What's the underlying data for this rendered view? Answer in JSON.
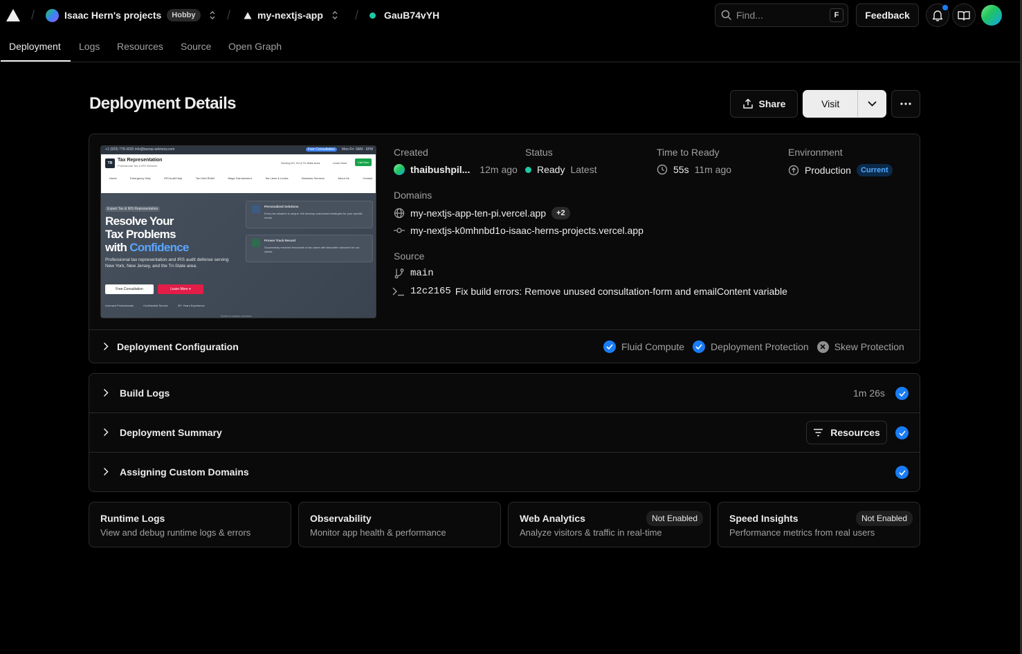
{
  "topbar": {
    "team": "Isaac Hern's projects",
    "plan": "Hobby",
    "project": "my-nextjs-app",
    "deployment_id": "GauB74vYH",
    "search_placeholder": "Find...",
    "search_shortcut": "F",
    "feedback": "Feedback"
  },
  "tabs": [
    "Deployment",
    "Logs",
    "Resources",
    "Source",
    "Open Graph"
  ],
  "page_title": "Deployment Details",
  "actions": {
    "share": "Share",
    "visit": "Visit"
  },
  "details": {
    "created_label": "Created",
    "created_user": "thaibushpil...",
    "created_ago": "12m ago",
    "status_label": "Status",
    "status_value": "Ready",
    "status_tag": "Latest",
    "time_label": "Time to Ready",
    "time_value": "55s",
    "time_ago": "11m ago",
    "env_label": "Environment",
    "env_value": "Production",
    "env_badge": "Current",
    "domains_label": "Domains",
    "domain_primary": "my-nextjs-app-ten-pi.vercel.app",
    "domain_more": "+2",
    "domain_secondary": "my-nextjs-k0mhnbd1o-isaac-herns-projects.vercel.app",
    "source_label": "Source",
    "branch": "main",
    "commit_hash": "12c2165",
    "commit_message": "Fix build errors: Remove unused consultation-form and emailContent variable"
  },
  "preview": {
    "topline": "+1 (929) 778-3020     info@taxrep-advisory.com",
    "pill_left": "Free Consultation",
    "pill_right": "Mon-Fri: 9AM - 6PM",
    "logo": "TR",
    "brand": "Tax Representation",
    "brand_sub": "Professional Tax & IRS Services",
    "serving": "Serving NY, NJ & Tri-State Area",
    "learn_more_nav": "Learn More",
    "call_now": "Call Now",
    "menu": [
      "Home",
      "Emergency Help",
      "IRS Audit Help",
      "Tax Debt Relief",
      "Wage Garnishment",
      "Tax Liens & Levies",
      "Business Services",
      "About Us",
      "Contact"
    ],
    "hero_tag": "Expert Tax & IRS Representation",
    "hero_line1": "Resolve Your",
    "hero_line2": "Tax Problems",
    "hero_line3a": "with ",
    "hero_line3b": "Confidence",
    "hero_body": "Professional tax representation and IRS audit defense serving New York, New Jersey, and the Tri-State area.",
    "btn_free": "Free Consultation",
    "btn_learn": "Learn More  ▾",
    "trust": [
      "Licensed Professionals",
      "Confidential Service",
      "20+ Years Experience"
    ],
    "card1_title": "Personalized Solutions",
    "card1_body": "Every tax situation is unique. We develop customized strategies for your specific needs.",
    "card2_title": "Proven Track Record",
    "card2_body": "Successfully resolved thousands of tax cases with favorable outcomes for our clients.",
    "scroll": "Scroll to explore services"
  },
  "config": {
    "title": "Deployment Configuration",
    "fluid": "Fluid Compute",
    "protection": "Deployment Protection",
    "skew": "Skew Protection"
  },
  "build": {
    "logs_title": "Build Logs",
    "duration": "1m 26s",
    "summary_title": "Deployment Summary",
    "resources": "Resources",
    "domains_title": "Assigning Custom Domains"
  },
  "cards": [
    {
      "title": "Runtime Logs",
      "sub": "View and debug runtime logs & errors"
    },
    {
      "title": "Observability",
      "sub": "Monitor app health & performance"
    },
    {
      "title": "Web Analytics",
      "sub": "Analyze visitors & traffic in real-time",
      "badge": "Not Enabled"
    },
    {
      "title": "Speed Insights",
      "sub": "Performance metrics from real users",
      "badge": "Not Enabled"
    }
  ],
  "colors": {
    "accent_blue": "#1a7cf5",
    "ready_green": "#1fc7a6",
    "link_blue": "#52a8ff"
  }
}
